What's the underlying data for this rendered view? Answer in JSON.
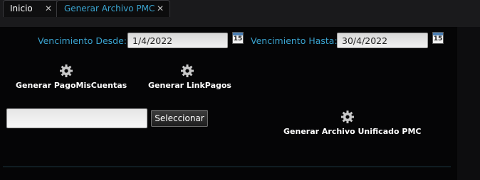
{
  "tabs": [
    {
      "label": "Inicio",
      "close": "✕"
    },
    {
      "label": "Generar Archivo PMC",
      "close": "✕"
    }
  ],
  "form": {
    "desde_label": "Vencimiento Desde:",
    "desde_value": "1/4/2022",
    "hasta_label": "Vencimiento Hasta:",
    "hasta_value": "30/4/2022",
    "calendar_day": "15"
  },
  "actions": {
    "pago_mis_cuentas": "Generar PagoMisCuentas",
    "link_pagos": "Generar LinkPagos",
    "unificado": "Generar Archivo Unificado PMC"
  },
  "file": {
    "value": "",
    "select_label": "Seleccionar"
  },
  "colors": {
    "accent": "#3aa3cf",
    "background": "#050506"
  }
}
